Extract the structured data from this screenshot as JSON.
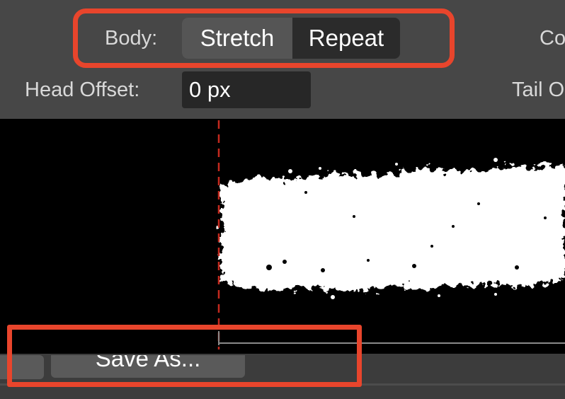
{
  "body_mode": {
    "label": "Body:",
    "options": [
      "Stretch",
      "Repeat"
    ],
    "selected": "Stretch"
  },
  "right_labels": {
    "top": "Co",
    "bottom": "Tail O"
  },
  "head_offset": {
    "label": "Head Offset:",
    "value": "0 px"
  },
  "actions": {
    "save_as_label": "Save As..."
  },
  "colors": {
    "panel": "#474747",
    "canvas": "#000000",
    "guide_line": "#c42a1e",
    "highlight": "#e8452c",
    "brush": "#ffffff"
  }
}
